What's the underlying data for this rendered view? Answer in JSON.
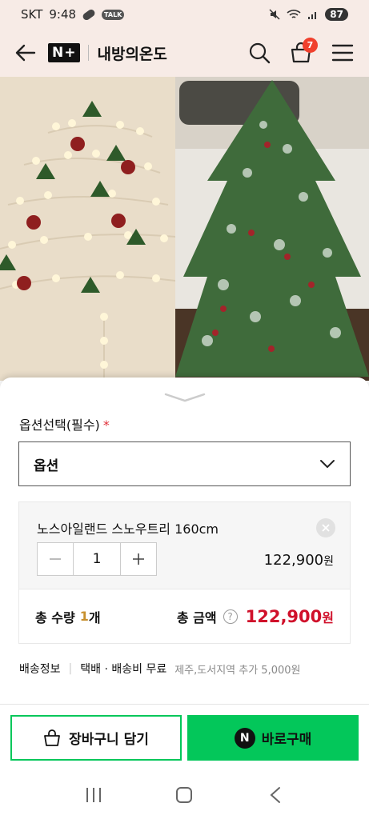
{
  "status_bar": {
    "carrier": "SKT",
    "time": "9:48",
    "talk_badge": "TALK",
    "battery": "87"
  },
  "header": {
    "logo_text": "N+",
    "store_name": "내방의온도",
    "cart_count": "7"
  },
  "sheet": {
    "option_label": "옵션선택(필수)",
    "required_mark": "*",
    "select_value": "옵션",
    "item": {
      "name": "노스아일랜드 스노우트리 160cm",
      "quantity": "1",
      "price": "122,900",
      "price_unit": "원"
    },
    "total": {
      "qty_label": "총 수량",
      "qty_value": "1",
      "qty_unit": "개",
      "amount_label": "총 금액",
      "help": "?",
      "amount_value": "122,900",
      "amount_unit": "원"
    },
    "shipping": {
      "title": "배송정보",
      "method": "택배 · 배송비 무료",
      "extra": "제주,도서지역 추가 5,000원"
    },
    "buttons": {
      "cart": "장바구니 담기",
      "buy_icon": "N",
      "buy": "바로구매"
    }
  },
  "colors": {
    "accent_green": "#03c75a",
    "price_red": "#d0112b",
    "badge_red": "#f0402d",
    "qty_gold": "#c7902e",
    "header_bg": "#f7ebe6"
  },
  "icons": {
    "back": "arrow-left-icon",
    "search": "search-icon",
    "cart": "shopping-bag-icon",
    "menu": "hamburger-menu-icon",
    "remove": "close-circle-icon",
    "dropdown": "chevron-down-icon",
    "nav_recents": "recent-apps-icon",
    "nav_home": "home-icon",
    "nav_back": "nav-back-icon"
  }
}
